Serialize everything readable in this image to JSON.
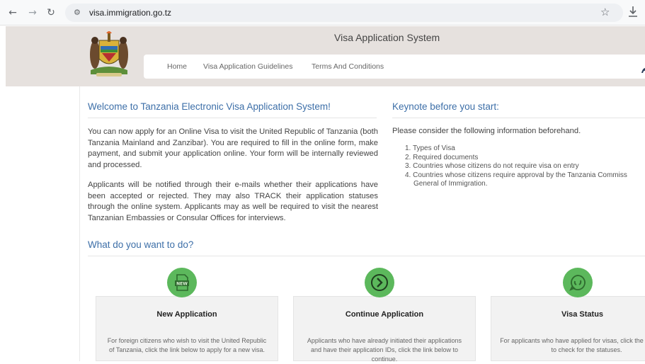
{
  "browser": {
    "url": "visa.immigration.go.tz",
    "icons": [
      "back-arrow-icon",
      "forward-arrow-icon",
      "reload-icon",
      "site-settings-icon",
      "bookmark-star-icon",
      "download-icon"
    ]
  },
  "header": {
    "system_title": "Visa Application System",
    "nav": [
      "Home",
      "Visa Application Guidelines",
      "Terms And Conditions"
    ]
  },
  "welcome": {
    "title": "Welcome to Tanzania Electronic Visa Application System!",
    "p1": "You can now apply for an Online Visa to visit the United Republic of Tanzania (both Tanzania Mainland and Zanzibar). You are required to fill in the online form, make payment, and submit your application online. Your form will be internally reviewed and processed.",
    "p2": "Applicants will be notified through their e-mails whether their applications have been accepted or rejected. They may also TRACK their application statuses through the online system. Applicants may as well be required to visit the nearest Tanzanian Embassies or Consular Offices for interviews."
  },
  "keynote": {
    "title": "Keynote before you start:",
    "intro": "Please consider the following information beforehand.",
    "items": [
      "1. Types of Visa",
      "2. Required documents",
      "3. Countries whose citizens do not require visa on entry",
      "4. Countries whose citizens require approval by the Tanzania Commiss",
      "General of Immigration."
    ]
  },
  "actions": {
    "title": "What do you want to do?",
    "cards": [
      {
        "title": "New Application",
        "text": "For foreign citizens who wish to visit the United Republic of Tanzania, click the link below to apply for a new visa.",
        "icon": "new-document-icon"
      },
      {
        "title": "Continue Application",
        "text": "Applicants who have already initiated their applications and have their application IDs, click the link below to continue.",
        "icon": "continue-arrow-icon"
      },
      {
        "title": "Visa Status",
        "text": "For applicants who have applied for visas, click the link below to check for the statuses.",
        "icon": "status-chat-icon"
      }
    ]
  },
  "colors": {
    "heading_blue": "#3d6fa8",
    "badge_green": "#5cb85c",
    "header_bg": "#e6e1de"
  }
}
